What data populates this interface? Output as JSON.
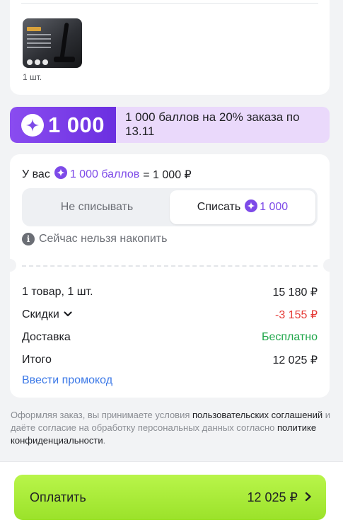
{
  "product": {
    "quantity": "1 шт.",
    "image_icon": "vacuum-cleaner-thumbnail"
  },
  "points_banner": {
    "amount": "1 000",
    "text": "1 000 баллов на 20% заказа по 13.11",
    "accent_color": "#7d4ae8",
    "background_color": "#ead9fb"
  },
  "bonus": {
    "prefix": "У вас",
    "balance_label": "1 000 баллов",
    "equals": "= 1 000 ₽",
    "options": {
      "keep_label": "Не списывать",
      "use_label": "Списать",
      "use_amount": "1 000",
      "selected": "use"
    },
    "notice": "Сейчас нельзя накопить"
  },
  "summary": {
    "rows": [
      {
        "label": "1 товар, 1 шт.",
        "value": "15 180 ₽"
      },
      {
        "label": "Скидки",
        "value": "-3 155 ₽"
      },
      {
        "label": "Доставка",
        "value": "Бесплатно"
      },
      {
        "label": "Итого",
        "value": "12 025 ₽"
      }
    ],
    "promo_link": "Ввести промокод",
    "discount_color": "#e53935",
    "free_color": "#1fa64a"
  },
  "legal": {
    "part1": "Оформляя заказ, вы принимаете условия ",
    "link1": "пользовательских соглашений",
    "part2": " и даёте согласие на обработку персональных данных согласно ",
    "link2": "политике конфиденциальности",
    "part3": "."
  },
  "pay_button": {
    "label": "Оплатить",
    "amount": "12 025 ₽",
    "color": "#a8ea34"
  }
}
